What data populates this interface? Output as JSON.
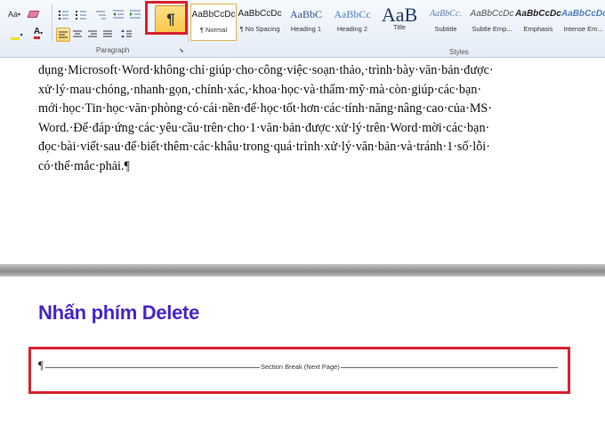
{
  "ribbon": {
    "paragraph_group_label": "Paragraph",
    "styles_group_label": "Styles",
    "font_color_letter": "A",
    "text_effects_glyph": "Aa",
    "pilcrow": "¶",
    "styles": [
      {
        "preview": "AaBbCcDc",
        "name": "¶ Normal",
        "color": "#222222"
      },
      {
        "preview": "AaBbCcDc",
        "name": "¶ No Spacing",
        "color": "#222222"
      },
      {
        "preview": "AaBbC",
        "name": "Heading 1",
        "color": "#2e5395"
      },
      {
        "preview": "AaBbCc",
        "name": "Heading 2",
        "color": "#4f7fbf"
      },
      {
        "preview": "AaB",
        "name": "Title",
        "color": "#1f3864"
      },
      {
        "preview": "AaBbCc.",
        "name": "Subtitle",
        "color": "#5b7fb0"
      },
      {
        "preview": "AaBbCcDc",
        "name": "Subtle Emp...",
        "color": "#555555"
      },
      {
        "preview": "AaBbCcDc",
        "name": "Emphasis",
        "color": "#222222"
      },
      {
        "preview": "AaBbCcDc",
        "name": "Intense Em...",
        "color": "#4f7fbf"
      }
    ]
  },
  "document": {
    "lines": [
      "dụng·Microsoft·Word·không·chỉ·giúp·cho·công·việc·soạn·thảo,·trình·bày·văn·bản·được·",
      "xử·lý·mau·chóng,·nhanh·gọn,·chính·xác,·khoa·học·và·thẩm·mỹ·mà·còn·giúp·các·bạn·",
      "mới·học·Tin·học·văn·phòng·có·cái·nền·để·học·tốt·hơn·các·tính·năng·nâng·cao·của·MS·",
      "Word.·Để·đáp·ứng·các·yêu·cầu·trên·cho·1·văn·bản·được·xử·lý·trên·Word·mời·các·bạn·",
      "đọc·bài·viết·sau·để·biết·thêm·các·khâu·trong·quá·trình·xử·lý·văn·bản·và·tránh·1·số·lỗi·",
      "có·thể·mắc·phải.¶"
    ]
  },
  "annotation": {
    "caption": "Nhấn phím Delete",
    "highlight_color": "#d8232f",
    "caption_color": "#4426c9"
  },
  "section_break": {
    "pilcrow": "¶",
    "label": "Section Break (Next Page)"
  }
}
